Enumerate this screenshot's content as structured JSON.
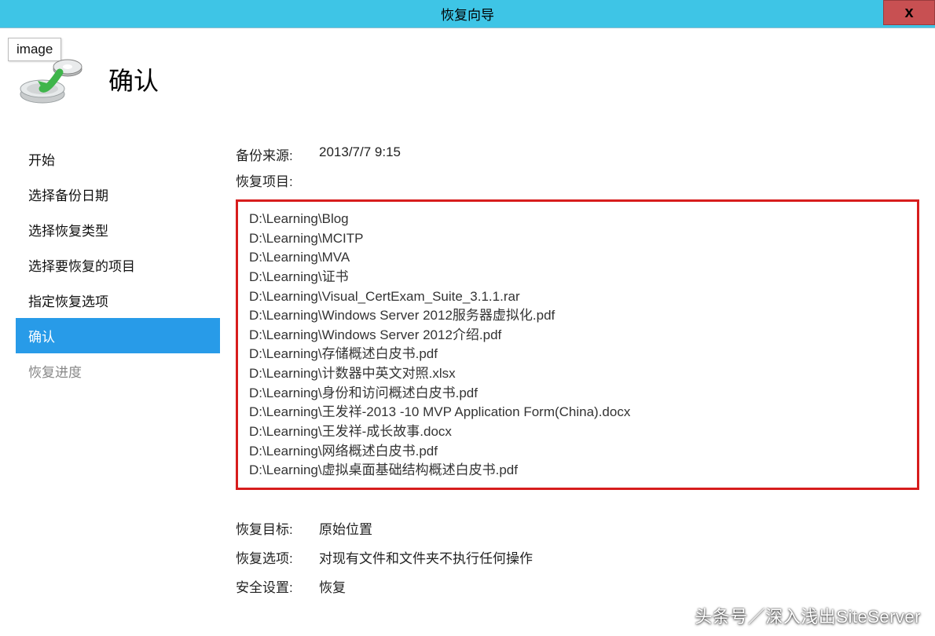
{
  "titlebar": {
    "title": "恢复向导",
    "close": "x"
  },
  "tooltip": "image",
  "header": {
    "title": "确认"
  },
  "sidebar": {
    "items": [
      {
        "label": "开始",
        "state": "normal"
      },
      {
        "label": "选择备份日期",
        "state": "normal"
      },
      {
        "label": "选择恢复类型",
        "state": "normal"
      },
      {
        "label": "选择要恢复的项目",
        "state": "normal"
      },
      {
        "label": "指定恢复选项",
        "state": "normal"
      },
      {
        "label": "确认",
        "state": "active"
      },
      {
        "label": "恢复进度",
        "state": "disabled"
      }
    ]
  },
  "main": {
    "backup_source_label": "备份来源:",
    "backup_source_value": "2013/7/7 9:15",
    "restore_items_label": "恢复项目:",
    "items": [
      "D:\\Learning\\Blog",
      "D:\\Learning\\MCITP",
      "D:\\Learning\\MVA",
      "D:\\Learning\\证书",
      "D:\\Learning\\Visual_CertExam_Suite_3.1.1.rar",
      "D:\\Learning\\Windows Server 2012服务器虚拟化.pdf",
      "D:\\Learning\\Windows Server 2012介绍.pdf",
      "D:\\Learning\\存储概述白皮书.pdf",
      "D:\\Learning\\计数器中英文对照.xlsx",
      "D:\\Learning\\身份和访问概述白皮书.pdf",
      "D:\\Learning\\王发祥-2013 -10 MVP Application Form(China).docx",
      "D:\\Learning\\王发祥-成长故事.docx",
      "D:\\Learning\\网络概述白皮书.pdf",
      "D:\\Learning\\虚拟桌面基础结构概述白皮书.pdf"
    ],
    "restore_target_label": "恢复目标:",
    "restore_target_value": "原始位置",
    "restore_option_label": "恢复选项:",
    "restore_option_value": "对现有文件和文件夹不执行任何操作",
    "security_label": "安全设置:",
    "security_value": "恢复"
  },
  "watermark": "头条号／深入浅出SiteServer"
}
